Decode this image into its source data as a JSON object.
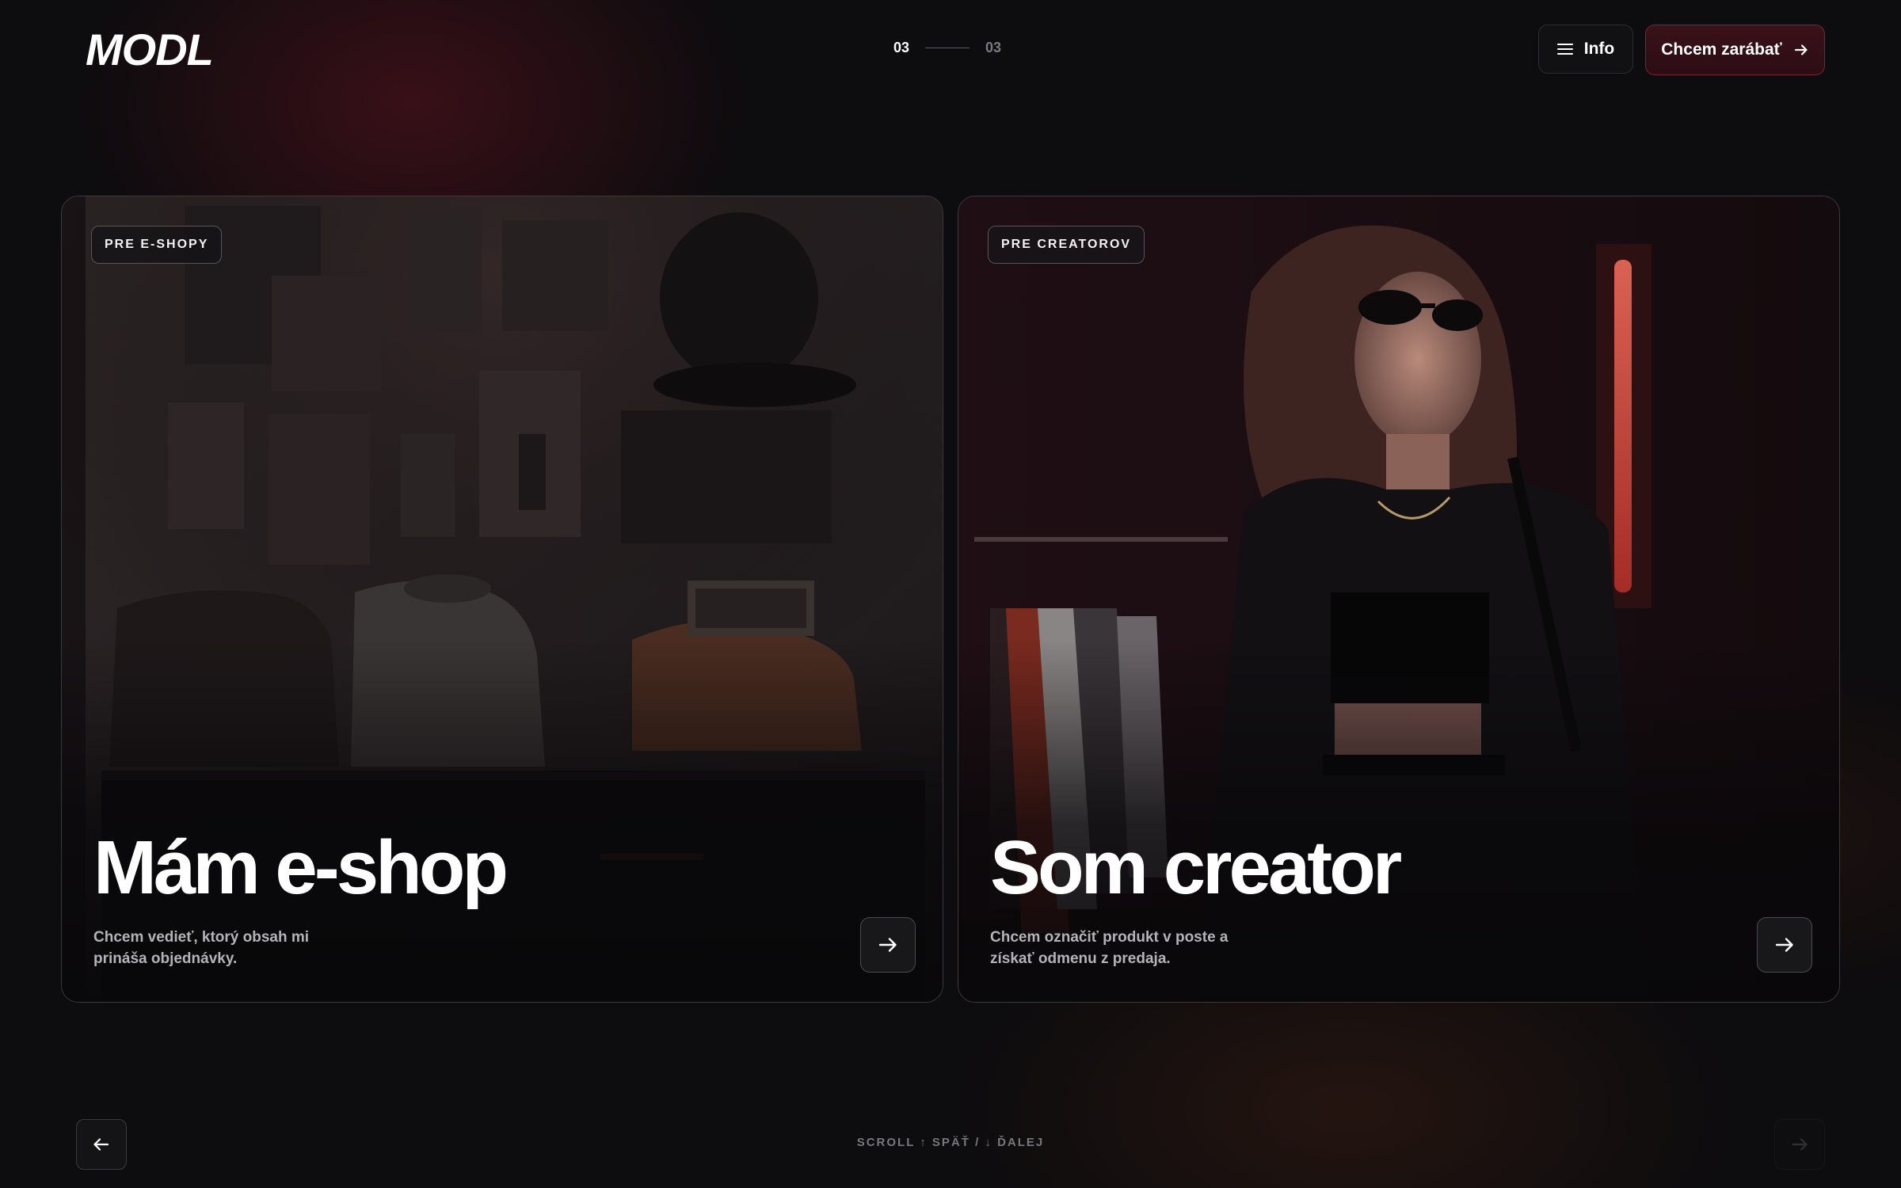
{
  "header": {
    "logo": "MODL",
    "pager": {
      "current": "03",
      "total": "03"
    },
    "info_label": "Info",
    "cta_label": "Chcem zarábať"
  },
  "cards": [
    {
      "tag": "PRE E-SHOPY",
      "title": "Mám e-shop",
      "description": "Chcem vedieť, ktorý obsah mi prináša objednávky."
    },
    {
      "tag": "PRE CREATOROV",
      "title": "Som creator",
      "description": "Chcem označiť produkt v poste a získať odmenu z predaja."
    }
  ],
  "footer": {
    "scroll_hint": "SCROLL ↑ SPÄŤ / ↓ ĎALEJ"
  },
  "colors": {
    "background": "#0d0c0e",
    "accent": "#7a2435",
    "accent_fill": "#2c0d14",
    "text_muted": "#b3b3b8"
  },
  "icons": [
    "menu-icon",
    "arrow-right-icon",
    "arrow-left-icon"
  ]
}
